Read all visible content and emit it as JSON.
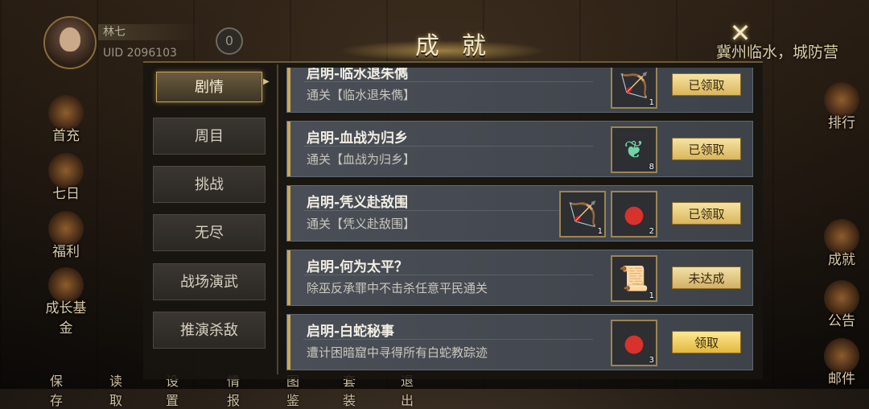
{
  "player": {
    "name": "林七",
    "uid": "UID  2096103",
    "coin_symbol": "0"
  },
  "location": "冀州临水，城防营",
  "title": "成就",
  "left_menu": [
    {
      "label": "首充",
      "icon": "gift-chest-icon"
    },
    {
      "label": "七日",
      "icon": "seven-day-icon"
    },
    {
      "label": "福利",
      "icon": "welfare-box-icon"
    },
    {
      "label": "成长基金",
      "icon": "gold-coins-icon"
    }
  ],
  "right_menu": [
    {
      "label": "排行",
      "icon": "ranking-icon"
    },
    {
      "label": "成就",
      "icon": "achievement-icon"
    },
    {
      "label": "公告",
      "icon": "announcement-horn-icon"
    },
    {
      "label": "邮件",
      "icon": "mail-icon"
    }
  ],
  "bottom_bar": [
    "保存",
    "读取",
    "设置",
    "情报",
    "图鉴",
    "套装",
    "退出"
  ],
  "tabs": [
    {
      "label": "剧情",
      "active": true
    },
    {
      "label": "周目",
      "active": false
    },
    {
      "label": "挑战",
      "active": false
    },
    {
      "label": "无尽",
      "active": false
    },
    {
      "label": "战场演武",
      "active": false
    },
    {
      "label": "推演杀敌",
      "active": false
    }
  ],
  "achievements": [
    {
      "title": "启明-临水退朱儁",
      "desc": "通关【临水退朱儁】",
      "button": "已领取",
      "status": "claimed",
      "rewards": [
        {
          "icon": "bow-icon",
          "qty": "1"
        }
      ]
    },
    {
      "title": "启明-血战为归乡",
      "desc": "通关【血战为归乡】",
      "button": "已领取",
      "status": "claimed",
      "rewards": [
        {
          "icon": "jade-herb-icon",
          "qty": "8"
        }
      ]
    },
    {
      "title": "启明-凭义赴敌围",
      "desc": "通关【凭义赴敌围】",
      "button": "已领取",
      "status": "claimed",
      "rewards": [
        {
          "icon": "bow-icon",
          "qty": "1"
        },
        {
          "icon": "red-pouch-icon",
          "qty": "2"
        }
      ]
    },
    {
      "title": "启明-何为太平？",
      "desc": "除巫反承罪中不击杀任意平民通关",
      "button": "未达成",
      "status": "unreached",
      "rewards": [
        {
          "icon": "scroll-map-icon",
          "qty": "1"
        }
      ]
    },
    {
      "title": "启明-白蛇秘事",
      "desc": "遭计困暗窟中寻得所有白蛇教踪迹",
      "button": "领取",
      "status": "claimable",
      "rewards": [
        {
          "icon": "red-pouch-icon",
          "qty": "3"
        }
      ]
    }
  ]
}
